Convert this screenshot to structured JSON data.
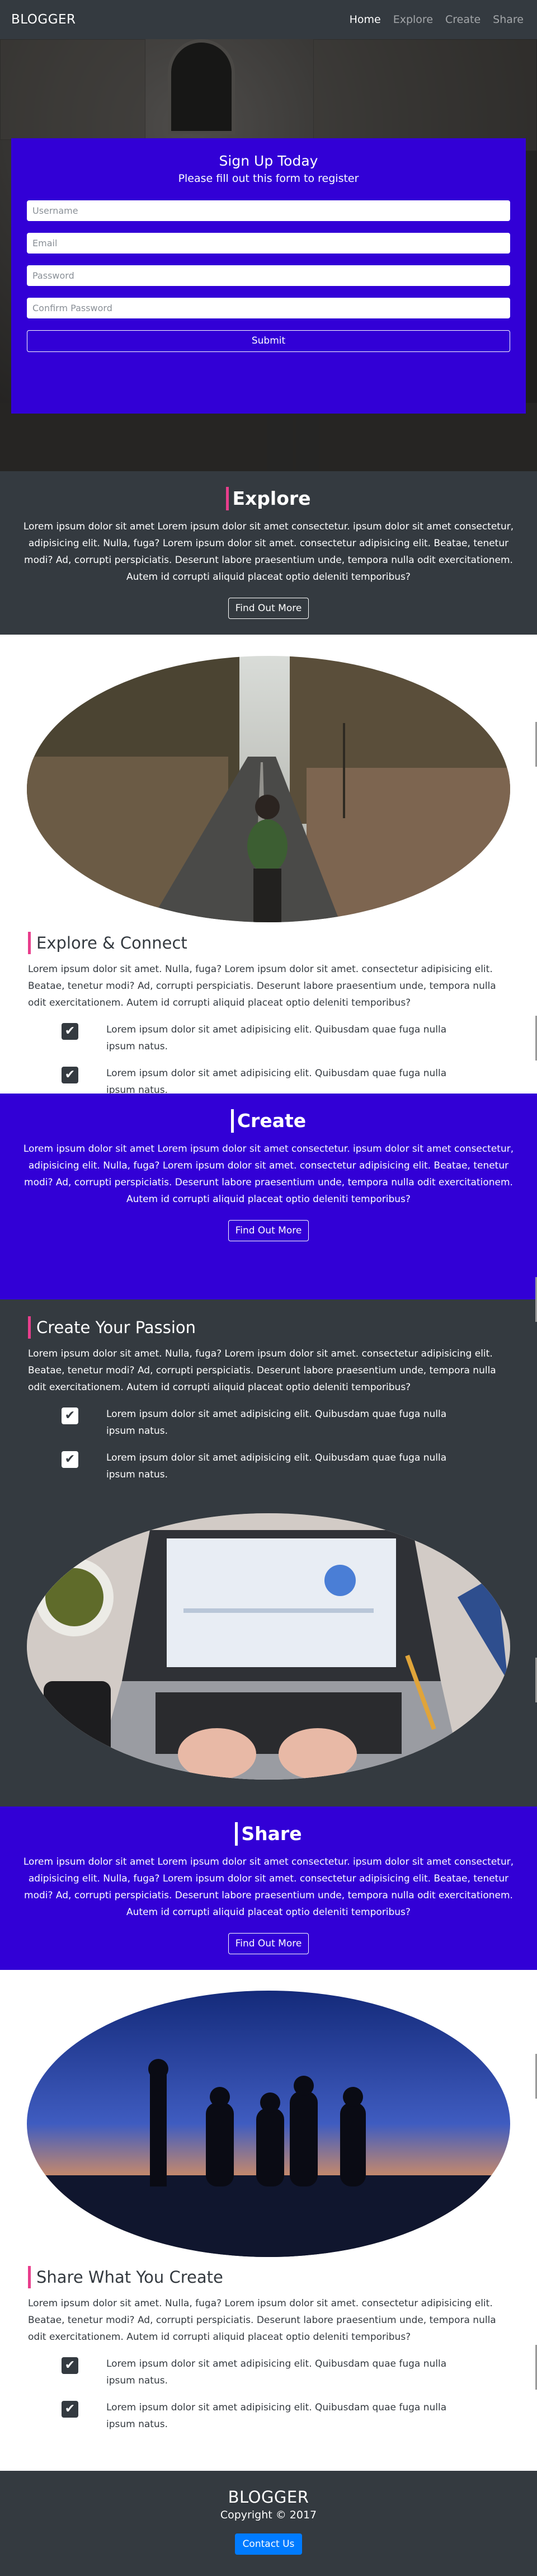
{
  "navbar": {
    "brand": "BLOGGER",
    "links": [
      "Home",
      "Explore",
      "Create",
      "Share"
    ]
  },
  "signup": {
    "title": "Sign Up Today",
    "subtitle": "Please fill out this form to register",
    "fields": [
      "Username",
      "Email",
      "Password",
      "Confirm Password"
    ],
    "submit_label": "Submit"
  },
  "explore": {
    "title": "Explore",
    "body": "Lorem ipsum dolor sit amet Lorem ipsum dolor sit amet consectetur. ipsum dolor sit amet consectetur, adipisicing elit. Nulla, fuga? Lorem ipsum dolor sit amet. consectetur adipisicing elit. Beatae, tenetur modi? Ad, corrupti perspiciatis. Deserunt labore praesentium unde, tempora nulla odit exercitationem. Autem id corrupti aliquid placeat optio deleniti temporibus?",
    "button": "Find Out More"
  },
  "explore_connect": {
    "title": "Explore & Connect",
    "body": "Lorem ipsum dolor sit amet. Nulla, fuga? Lorem ipsum dolor sit amet. consectetur adipisicing elit. Beatae, tenetur modi? Ad, corrupti perspiciatis. Deserunt labore praesentium unde, tempora nulla odit exercitationem. Autem id corrupti aliquid placeat optio deleniti temporibus?",
    "checks": [
      "Lorem ipsum dolor sit amet adipisicing elit. Quibusdam quae fuga nulla ipsum natus.",
      "Lorem ipsum dolor sit amet adipisicing elit. Quibusdam quae fuga nulla ipsum natus."
    ]
  },
  "create": {
    "title": "Create",
    "body": "Lorem ipsum dolor sit amet Lorem ipsum dolor sit amet consectetur. ipsum dolor sit amet consectetur, adipisicing elit. Nulla, fuga? Lorem ipsum dolor sit amet. consectetur adipisicing elit. Beatae, tenetur modi? Ad, corrupti perspiciatis. Deserunt labore praesentium unde, tempora nulla odit exercitationem. Autem id corrupti aliquid placeat optio deleniti temporibus?",
    "button": "Find Out More"
  },
  "create_passion": {
    "title": "Create Your Passion",
    "body": "Lorem ipsum dolor sit amet. Nulla, fuga? Lorem ipsum dolor sit amet. consectetur adipisicing elit. Beatae, tenetur modi? Ad, corrupti perspiciatis. Deserunt labore praesentium unde, tempora nulla odit exercitationem. Autem id corrupti aliquid placeat optio deleniti temporibus?",
    "checks": [
      "Lorem ipsum dolor sit amet adipisicing elit. Quibusdam quae fuga nulla ipsum natus.",
      "Lorem ipsum dolor sit amet adipisicing elit. Quibusdam quae fuga nulla ipsum natus."
    ]
  },
  "share": {
    "title": "Share",
    "body": "Lorem ipsum dolor sit amet Lorem ipsum dolor sit amet consectetur. ipsum dolor sit amet consectetur, adipisicing elit. Nulla, fuga? Lorem ipsum dolor sit amet. consectetur adipisicing elit. Beatae, tenetur modi? Ad, corrupti perspiciatis. Deserunt labore praesentium unde, tempora nulla odit exercitationem. Autem id corrupti aliquid placeat optio deleniti temporibus?",
    "button": "Find Out More"
  },
  "share_create": {
    "title": "Share What You Create",
    "body": "Lorem ipsum dolor sit amet. Nulla, fuga? Lorem ipsum dolor sit amet. consectetur adipisicing elit. Beatae, tenetur modi? Ad, corrupti perspiciatis. Deserunt labore praesentium unde, tempora nulla odit exercitationem. Autem id corrupti aliquid placeat optio deleniti temporibus?",
    "checks": [
      "Lorem ipsum dolor sit amet adipisicing elit. Quibusdam quae fuga nulla ipsum natus.",
      "Lorem ipsum dolor sit amet adipisicing elit. Quibusdam quae fuga nulla ipsum natus."
    ]
  },
  "footer": {
    "title": "BLOGGER",
    "copyright": "Copyright © 2017",
    "contact_label": "Contact Us"
  },
  "icons": {
    "check": "check-square-icon"
  },
  "colors": {
    "dark": "#343a40",
    "violet": "#3200d6",
    "accent_pink": "#e83e8c",
    "contact_blue": "#007bff"
  }
}
